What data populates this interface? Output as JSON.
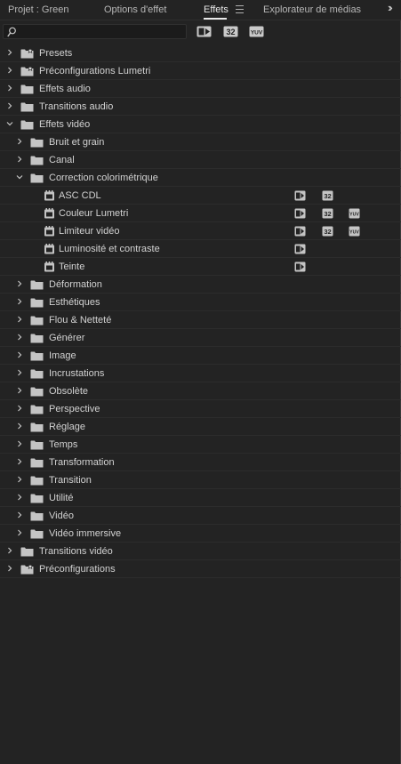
{
  "tabs": [
    {
      "label": "Projet : Green",
      "active": false
    },
    {
      "label": "Options d'effet",
      "active": false
    },
    {
      "label": "Effets",
      "active": true
    },
    {
      "label": "Explorateur de médias",
      "active": false
    }
  ],
  "toolbar": {
    "search_value": "",
    "badges": [
      "accelerated",
      "32",
      "YUV"
    ]
  },
  "badge_text": {
    "b32": "32",
    "yuv": "YUV"
  },
  "tree": [
    {
      "label": "Presets",
      "level": 0,
      "expanded": false,
      "icon": "star-folder"
    },
    {
      "label": "Préconfigurations Lumetri",
      "level": 0,
      "expanded": false,
      "icon": "star-folder"
    },
    {
      "label": "Effets audio",
      "level": 0,
      "expanded": false,
      "icon": "folder"
    },
    {
      "label": "Transitions audio",
      "level": 0,
      "expanded": false,
      "icon": "folder"
    },
    {
      "label": "Effets vidéo",
      "level": 0,
      "expanded": true,
      "icon": "folder"
    },
    {
      "label": "Bruit et grain",
      "level": 1,
      "expanded": false,
      "icon": "folder"
    },
    {
      "label": "Canal",
      "level": 1,
      "expanded": false,
      "icon": "folder"
    },
    {
      "label": "Correction colorimétrique",
      "level": 1,
      "expanded": true,
      "icon": "folder"
    },
    {
      "label": "ASC CDL",
      "level": 2,
      "icon": "effect",
      "badges": [
        "accelerated",
        "32"
      ]
    },
    {
      "label": "Couleur Lumetri",
      "level": 2,
      "icon": "effect",
      "badges": [
        "accelerated",
        "32",
        "YUV"
      ]
    },
    {
      "label": "Limiteur vidéo",
      "level": 2,
      "icon": "effect",
      "badges": [
        "accelerated",
        "32",
        "YUV"
      ]
    },
    {
      "label": "Luminosité et contraste",
      "level": 2,
      "icon": "effect",
      "badges": [
        "accelerated"
      ]
    },
    {
      "label": "Teinte",
      "level": 2,
      "icon": "effect",
      "badges": [
        "accelerated"
      ]
    },
    {
      "label": "Déformation",
      "level": 1,
      "expanded": false,
      "icon": "folder"
    },
    {
      "label": "Esthétiques",
      "level": 1,
      "expanded": false,
      "icon": "folder"
    },
    {
      "label": "Flou & Netteté",
      "level": 1,
      "expanded": false,
      "icon": "folder"
    },
    {
      "label": "Générer",
      "level": 1,
      "expanded": false,
      "icon": "folder"
    },
    {
      "label": "Image",
      "level": 1,
      "expanded": false,
      "icon": "folder"
    },
    {
      "label": "Incrustations",
      "level": 1,
      "expanded": false,
      "icon": "folder"
    },
    {
      "label": "Obsolète",
      "level": 1,
      "expanded": false,
      "icon": "folder"
    },
    {
      "label": "Perspective",
      "level": 1,
      "expanded": false,
      "icon": "folder"
    },
    {
      "label": "Réglage",
      "level": 1,
      "expanded": false,
      "icon": "folder"
    },
    {
      "label": "Temps",
      "level": 1,
      "expanded": false,
      "icon": "folder"
    },
    {
      "label": "Transformation",
      "level": 1,
      "expanded": false,
      "icon": "folder"
    },
    {
      "label": "Transition",
      "level": 1,
      "expanded": false,
      "icon": "folder"
    },
    {
      "label": "Utilité",
      "level": 1,
      "expanded": false,
      "icon": "folder"
    },
    {
      "label": "Vidéo",
      "level": 1,
      "expanded": false,
      "icon": "folder"
    },
    {
      "label": "Vidéo immersive",
      "level": 1,
      "expanded": false,
      "icon": "folder"
    },
    {
      "label": "Transitions vidéo",
      "level": 0,
      "expanded": false,
      "icon": "folder"
    },
    {
      "label": "Préconfigurations",
      "level": 0,
      "expanded": false,
      "icon": "star-folder"
    }
  ],
  "colors": {
    "background": "#232323",
    "text": "#d2d2d2",
    "icon": "#c4c4c4",
    "divider": "#2c2c2c"
  }
}
